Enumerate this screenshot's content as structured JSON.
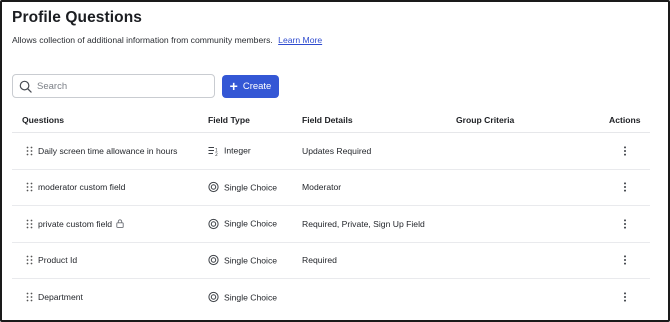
{
  "header": {
    "title": "Profile Questions",
    "description": "Allows collection of additional information from community members.",
    "learn_more": "Learn More"
  },
  "toolbar": {
    "search_placeholder": "Search",
    "create_label": "Create"
  },
  "table": {
    "columns": {
      "questions": "Questions",
      "field_type": "Field Type",
      "field_details": "Field Details",
      "group_criteria": "Group Criteria",
      "actions": "Actions"
    },
    "rows": [
      {
        "question": "Daily screen time allowance in hours",
        "field_type": "Integer",
        "field_type_icon": "integer-icon",
        "field_details": "Updates Required",
        "group_criteria": "",
        "private": false
      },
      {
        "question": "moderator custom field",
        "field_type": "Single Choice",
        "field_type_icon": "single-choice-icon",
        "field_details": "Moderator",
        "group_criteria": "",
        "private": false
      },
      {
        "question": "private custom field",
        "field_type": "Single Choice",
        "field_type_icon": "single-choice-icon",
        "field_details": "Required, Private, Sign Up Field",
        "group_criteria": "",
        "private": true
      },
      {
        "question": "Product Id",
        "field_type": "Single Choice",
        "field_type_icon": "single-choice-icon",
        "field_details": "Required",
        "group_criteria": "",
        "private": false
      },
      {
        "question": "Department",
        "field_type": "Single Choice",
        "field_type_icon": "single-choice-icon",
        "field_details": "",
        "group_criteria": "",
        "private": false
      }
    ]
  },
  "colors": {
    "accent": "#3457d5",
    "link": "#2f4bcf",
    "border": "#c9ccd1"
  }
}
